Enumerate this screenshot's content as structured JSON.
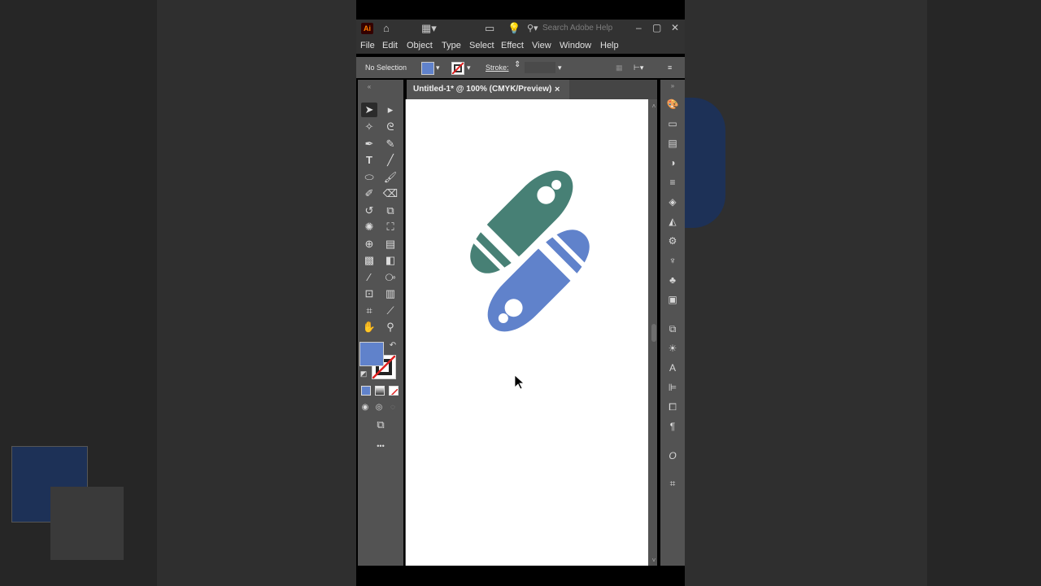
{
  "app": {
    "logo": "Ai",
    "search_placeholder": "Search Adobe Help"
  },
  "menu": [
    "File",
    "Edit",
    "Object",
    "Type",
    "Select",
    "Effect",
    "View",
    "Window",
    "Help"
  ],
  "control_bar": {
    "selection_status": "No Selection",
    "stroke_label": "Stroke:",
    "fill_color": "#6082cb"
  },
  "document": {
    "tab_title": "Untitled-1* @ 100% (CMYK/Preview)",
    "close_glyph": "×"
  },
  "artwork": {
    "teal_color": "#478075",
    "blue_color": "#6082cb"
  },
  "colors": {
    "fill_swatch": "#6082cb",
    "none_stroke": "#e02020"
  },
  "tools": {
    "more_glyph": "•••"
  }
}
